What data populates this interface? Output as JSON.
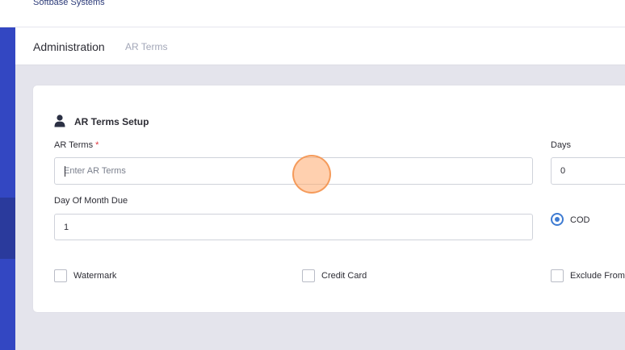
{
  "app": {
    "brand": "Softbase Systems"
  },
  "breadcrumb": {
    "section": "Administration",
    "page": "AR Terms"
  },
  "form": {
    "title": "AR Terms Setup",
    "ar_terms": {
      "label": "AR Terms",
      "required_mark": "*",
      "placeholder": "Enter AR Terms",
      "value": ""
    },
    "days": {
      "label": "Days",
      "value": "0"
    },
    "day_of_month_due": {
      "label": "Day Of Month Due",
      "value": "1"
    },
    "cod": {
      "label": "COD",
      "checked": true
    },
    "watermark": {
      "label": "Watermark",
      "checked": false
    },
    "credit_card": {
      "label": "Credit Card",
      "checked": false
    },
    "exclude_from": {
      "label": "Exclude From",
      "checked": false
    }
  },
  "colors": {
    "sidebar": "#3347c2",
    "accent": "#3e7bd2",
    "required": "#e0343c"
  },
  "icons": {
    "section": "person-icon"
  }
}
